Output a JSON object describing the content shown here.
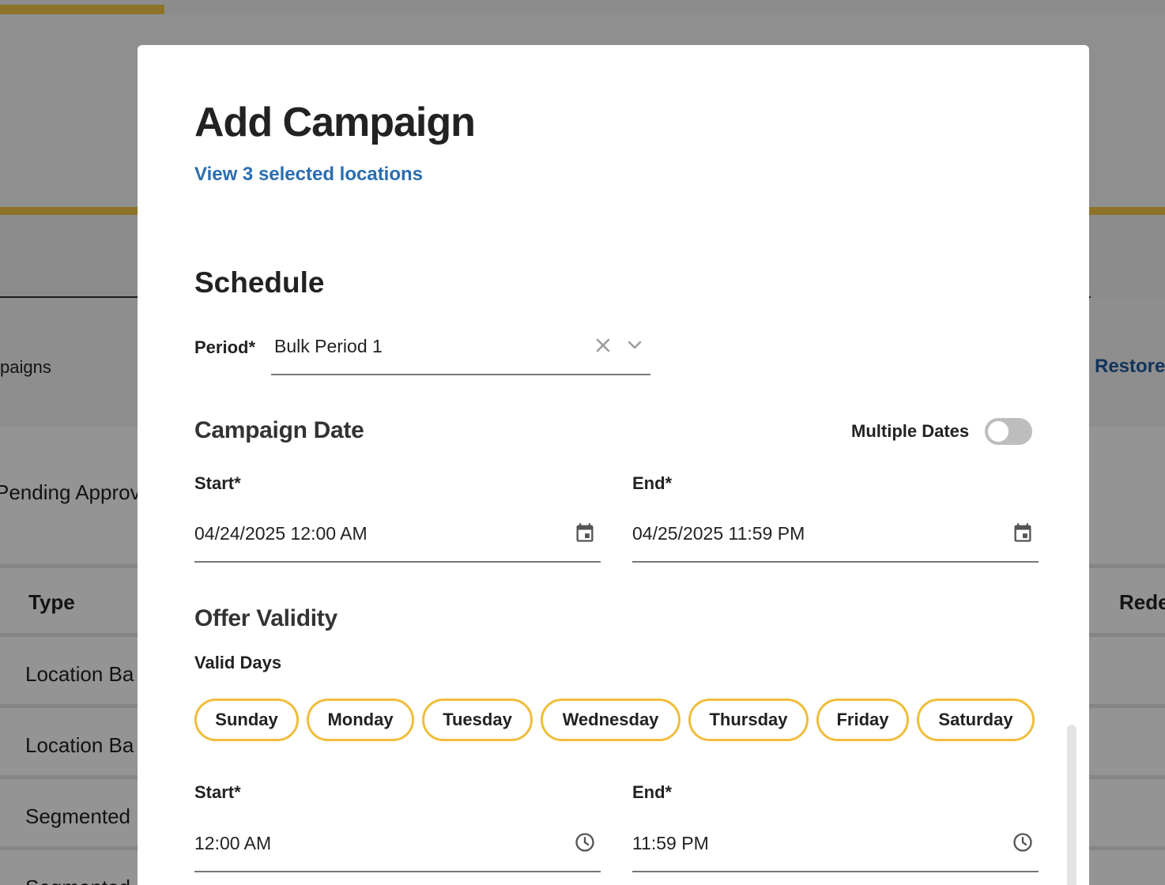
{
  "background": {
    "filter_label": "paigns",
    "restore_link": "Restore",
    "status_text": "Pending Approv",
    "table": {
      "col_type": "Type",
      "col_redeem": "Rede",
      "rows": [
        "Location Ba",
        "Location Ba",
        "Segmented",
        "Segmented"
      ]
    }
  },
  "modal": {
    "title": "Add Campaign",
    "locations_link": "View 3 selected locations",
    "schedule": {
      "title": "Schedule",
      "period_label": "Period*",
      "period_value": "Bulk Period 1"
    },
    "campaign_date": {
      "title": "Campaign Date",
      "multiple_dates_label": "Multiple Dates",
      "multiple_dates_on": false,
      "start_label": "Start*",
      "start_value": "04/24/2025  12:00 AM",
      "end_label": "End*",
      "end_value": "04/25/2025  11:59 PM"
    },
    "offer_validity": {
      "title": "Offer Validity",
      "valid_days_label": "Valid Days",
      "days": [
        "Sunday",
        "Monday",
        "Tuesday",
        "Wednesday",
        "Thursday",
        "Friday",
        "Saturday"
      ],
      "start_label": "Start*",
      "start_value": "12:00 AM",
      "end_label": "End*",
      "end_value": "11:59 PM"
    }
  },
  "colors": {
    "accent": "#f0bd3c",
    "link": "#2a6db0"
  },
  "icons": {
    "clear": "close-icon",
    "dropdown": "chevron-down-icon",
    "date": "calendar-icon",
    "time": "clock-icon"
  }
}
